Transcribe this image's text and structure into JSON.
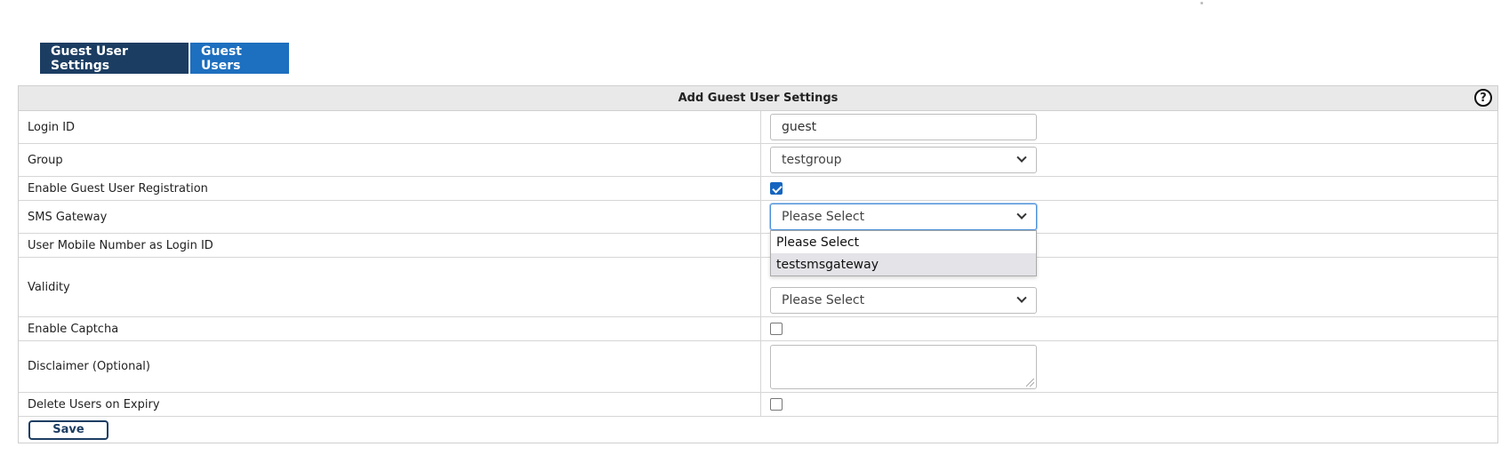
{
  "tabs": [
    {
      "label": "Guest User Settings",
      "active": true
    },
    {
      "label": "Guest Users",
      "active": false
    }
  ],
  "panel": {
    "title": "Add Guest User Settings",
    "help_symbol": "?"
  },
  "form": {
    "login_id": {
      "label": "Login ID",
      "value": "guest"
    },
    "group": {
      "label": "Group",
      "value": "testgroup"
    },
    "enable_registration": {
      "label": "Enable Guest User Registration",
      "checked": true
    },
    "sms_gateway": {
      "label": "SMS Gateway",
      "value": "Please Select",
      "options": [
        "Please Select",
        "testsmsgateway"
      ],
      "highlighted_option": "testsmsgateway"
    },
    "mobile_as_login": {
      "label": "User Mobile Number as Login ID"
    },
    "validity": {
      "label": "Validity",
      "value": "Please Select"
    },
    "enable_captcha": {
      "label": "Enable Captcha",
      "checked": false
    },
    "disclaimer": {
      "label": "Disclaimer (Optional)",
      "value": ""
    },
    "delete_on_expiry": {
      "label": "Delete Users on Expiry",
      "checked": false
    }
  },
  "actions": {
    "save_label": "Save"
  },
  "colors": {
    "tab_active": "#1c3d62",
    "tab_inactive": "#1d6fbf",
    "checkbox_checked": "#1565c0",
    "header_bg": "#e9e9e9"
  }
}
